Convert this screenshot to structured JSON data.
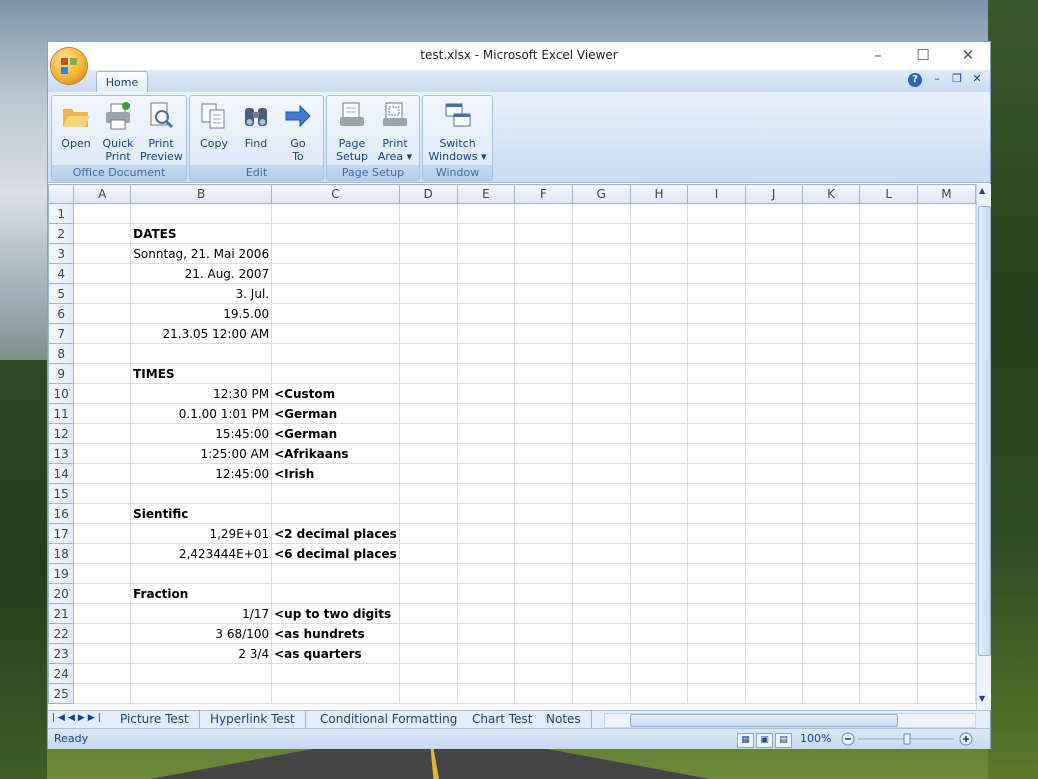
{
  "window": {
    "title": "test.xlsx - Microsoft Excel Viewer"
  },
  "ribbon": {
    "tab": "Home",
    "groups": [
      {
        "label": "Office Document",
        "buttons": [
          {
            "line1": "Open",
            "line2": ""
          },
          {
            "line1": "Quick",
            "line2": "Print"
          },
          {
            "line1": "Print",
            "line2": "Preview"
          }
        ]
      },
      {
        "label": "Edit",
        "buttons": [
          {
            "line1": "Copy",
            "line2": ""
          },
          {
            "line1": "Find",
            "line2": ""
          },
          {
            "line1": "Go",
            "line2": "To"
          }
        ]
      },
      {
        "label": "Page Setup",
        "buttons": [
          {
            "line1": "Page",
            "line2": "Setup"
          },
          {
            "line1": "Print",
            "line2": "Area ▾"
          }
        ]
      },
      {
        "label": "Window",
        "buttons": [
          {
            "line1": "Switch",
            "line2": "Windows ▾"
          }
        ]
      }
    ]
  },
  "sheet": {
    "columns": [
      "A",
      "B",
      "C",
      "D",
      "E",
      "F",
      "G",
      "H",
      "I",
      "J",
      "K",
      "L",
      "M"
    ],
    "rows": [
      {
        "n": "1",
        "b": "",
        "c": "",
        "style": ""
      },
      {
        "n": "2",
        "b": "DATES",
        "c": "",
        "style": "bold"
      },
      {
        "n": "3",
        "b": "Sonntag, 21. Mai 2006",
        "c": "",
        "style": "r"
      },
      {
        "n": "4",
        "b": "21. Aug. 2007",
        "c": "",
        "style": "r"
      },
      {
        "n": "5",
        "b": "3. Jul.",
        "c": "",
        "style": "r"
      },
      {
        "n": "6",
        "b": "19.5.00",
        "c": "",
        "style": "r"
      },
      {
        "n": "7",
        "b": "21.3.05 12:00 AM",
        "c": "",
        "style": "r"
      },
      {
        "n": "8",
        "b": "",
        "c": "",
        "style": ""
      },
      {
        "n": "9",
        "b": "TIMES",
        "c": "",
        "style": "bold"
      },
      {
        "n": "10",
        "b": "12:30 PM",
        "c": "<Custom",
        "style": "r"
      },
      {
        "n": "11",
        "b": "0.1.00 1:01 PM",
        "c": "<German",
        "style": "r"
      },
      {
        "n": "12",
        "b": "15:45:00",
        "c": "<German",
        "style": "r"
      },
      {
        "n": "13",
        "b": "1:25:00 AM",
        "c": "<Afrikaans",
        "style": "r"
      },
      {
        "n": "14",
        "b": "12:45:00",
        "c": "<Irish",
        "style": "r"
      },
      {
        "n": "15",
        "b": "",
        "c": "",
        "style": ""
      },
      {
        "n": "16",
        "b": "Sientific",
        "c": "",
        "style": "bold"
      },
      {
        "n": "17",
        "b": "1,29E+01",
        "c": "<2 decimal places",
        "style": "r"
      },
      {
        "n": "18",
        "b": "2,423444E+01",
        "c": "<6 decimal places",
        "style": "r"
      },
      {
        "n": "19",
        "b": "",
        "c": "",
        "style": ""
      },
      {
        "n": "20",
        "b": "Fraction",
        "c": "",
        "style": "bold"
      },
      {
        "n": "21",
        "b": "1/17",
        "c": "<up to two digits",
        "style": "r"
      },
      {
        "n": "22",
        "b": "3 68/100",
        "c": "<as hundrets",
        "style": "r"
      },
      {
        "n": "23",
        "b": "2 3/4",
        "c": "<as quarters",
        "style": "r"
      },
      {
        "n": "24",
        "b": "",
        "c": "",
        "style": ""
      },
      {
        "n": "25",
        "b": "",
        "c": "",
        "style": ""
      }
    ]
  },
  "sheet_tabs": [
    "Picture Test",
    "Hyperlink Test",
    "Conditional Formatting",
    "Chart Test",
    "Notes"
  ],
  "status": {
    "text": "Ready",
    "zoom": "100%"
  },
  "colors": {
    "ribbon": "#dce8f7",
    "accent": "#15428b"
  }
}
